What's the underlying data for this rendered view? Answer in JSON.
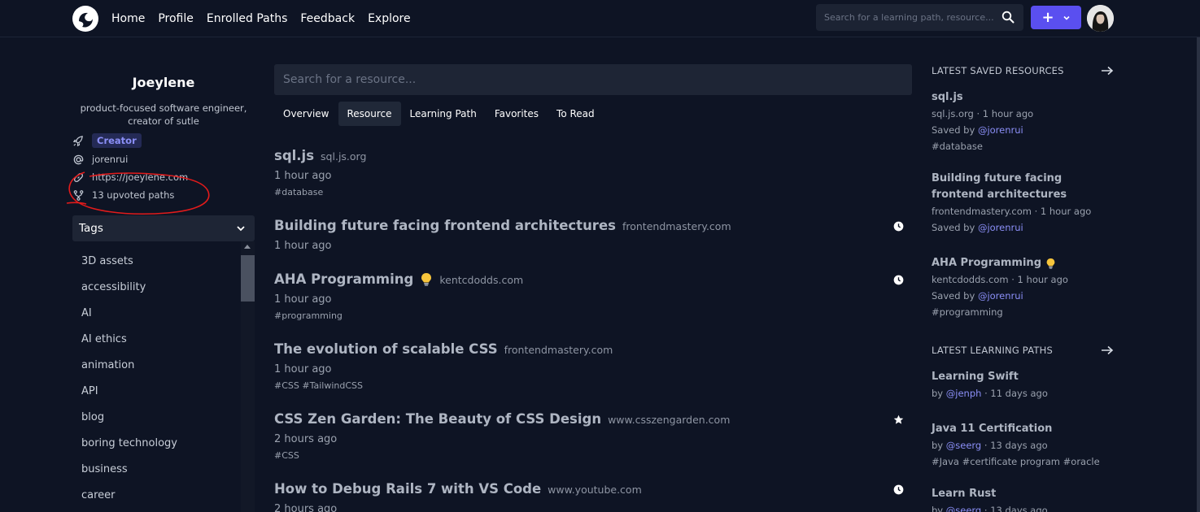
{
  "nav": {
    "links": [
      "Home",
      "Profile",
      "Enrolled Paths",
      "Feedback",
      "Explore"
    ],
    "search_placeholder": "Search for a learning path, resource...",
    "add_button_label": "+"
  },
  "profile": {
    "name": "Joeylene",
    "bio": "product-focused software engineer, creator of sutle",
    "badge": "Creator",
    "username": "jorenrui",
    "website": "https://joeylene.com",
    "upvoted": "13 upvoted paths"
  },
  "tags": {
    "header": "Tags",
    "items": [
      "3D assets",
      "accessibility",
      "AI",
      "AI ethics",
      "animation",
      "API",
      "blog",
      "boring technology",
      "business",
      "career"
    ]
  },
  "main": {
    "search_placeholder": "Search for a resource...",
    "tabs": [
      "Overview",
      "Resource",
      "Learning Path",
      "Favorites",
      "To Read"
    ],
    "active_tab": "Resource",
    "feed": [
      {
        "title": "sql.js",
        "domain": "sql.js.org",
        "time": "1 hour ago",
        "tags": "#database",
        "flag": ""
      },
      {
        "title": "Building future facing frontend architectures",
        "domain": "frontendmastery.com",
        "time": "1 hour ago",
        "tags": "",
        "flag": "clock"
      },
      {
        "title": "AHA Programming",
        "domain": "kentcdodds.com",
        "time": "1 hour ago",
        "tags": "#programming",
        "flag": "clock",
        "bulb": true
      },
      {
        "title": "The evolution of scalable CSS",
        "domain": "frontendmastery.com",
        "time": "1 hour ago",
        "tags": "#CSS #TailwindCSS",
        "flag": ""
      },
      {
        "title": "CSS Zen Garden: The Beauty of CSS Design",
        "domain": "www.csszengarden.com",
        "time": "2 hours ago",
        "tags": "#CSS",
        "flag": "star"
      },
      {
        "title": "How to Debug Rails 7 with VS Code",
        "domain": "www.youtube.com",
        "time": "2 hours ago",
        "tags": "",
        "flag": "clock"
      }
    ]
  },
  "right": {
    "saved_heading": "LATEST SAVED RESOURCES",
    "saved": [
      {
        "title": "sql.js",
        "meta": "sql.js.org · 1 hour ago",
        "saved_by": "Saved by ",
        "user": "@jorenrui",
        "tags": "#database"
      },
      {
        "title": "Building future facing frontend architectures",
        "meta": "frontendmastery.com · 1 hour ago",
        "saved_by": "Saved by ",
        "user": "@jorenrui",
        "tags": ""
      },
      {
        "title": "AHA Programming",
        "meta": "kentcdodds.com · 1 hour ago",
        "saved_by": "Saved by ",
        "user": "@jorenrui",
        "tags": "#programming",
        "bulb": true
      }
    ],
    "paths_heading": "LATEST LEARNING PATHS",
    "paths": [
      {
        "title": "Learning Swift",
        "by": "by ",
        "user": "@jenph",
        "ago": " · 11 days ago",
        "tags": ""
      },
      {
        "title": "Java 11 Certification",
        "by": "by ",
        "user": "@seerg",
        "ago": " · 13 days ago",
        "tags": "#Java #certificate program #oracle"
      },
      {
        "title": "Learn Rust",
        "by": "by ",
        "user": "@seerg",
        "ago": " · 13 days ago",
        "tags": ""
      }
    ]
  },
  "colors": {
    "accent": "#5a4ff0",
    "link": "#8b8ff7",
    "background": "#0e1424"
  }
}
